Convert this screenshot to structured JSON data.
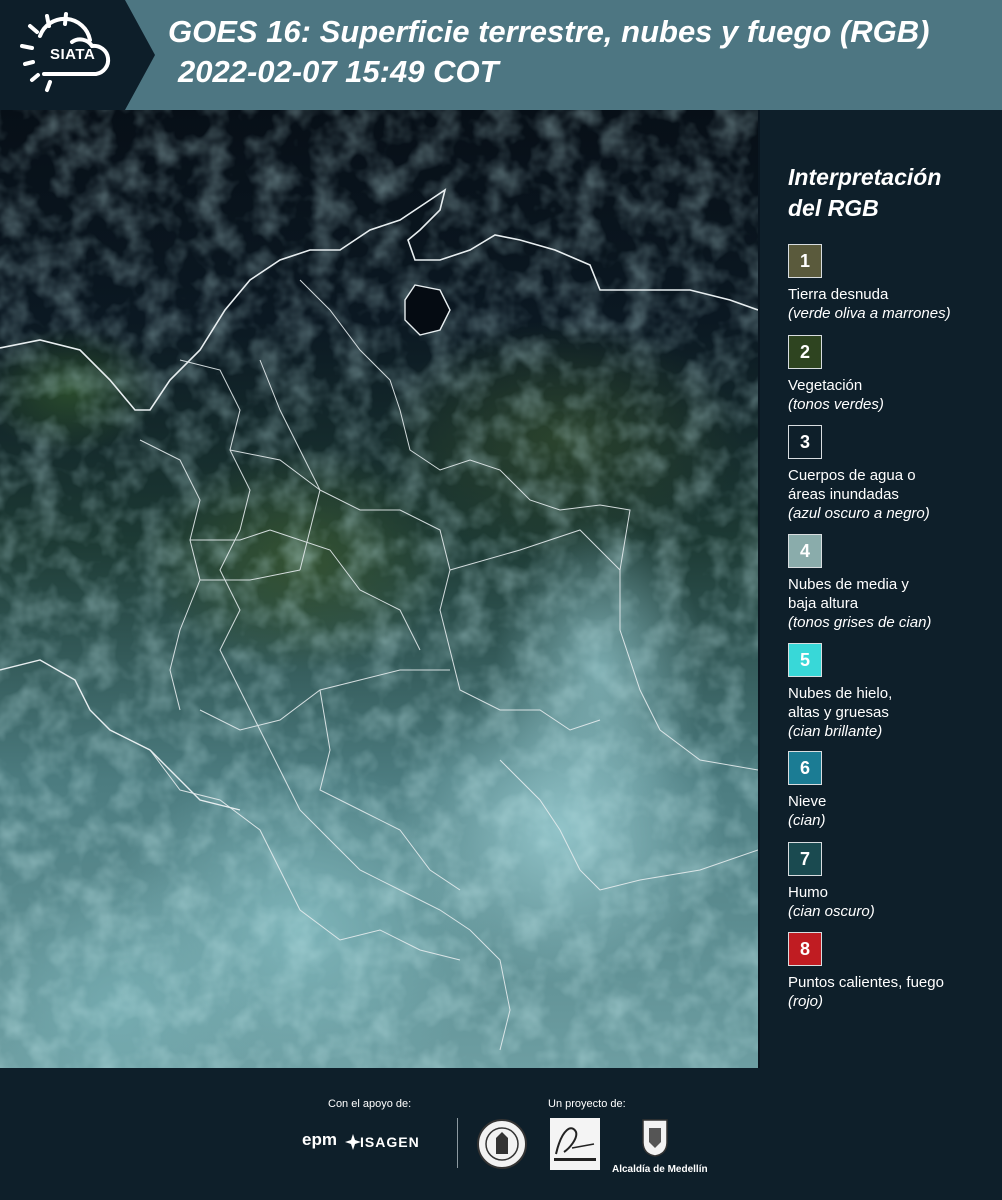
{
  "header": {
    "logo_text": "SIATA",
    "title_line1": "GOES 16: Superficie terrestre, nubes y fuego (RGB)",
    "title_line2": "2022-02-07 15:49 COT"
  },
  "legend": {
    "title_line1": "Interpretación",
    "title_line2": "del RGB",
    "items": [
      {
        "num": "1",
        "color": "#5a5a3c",
        "label": "Tierra desnuda",
        "sub": "(verde oliva a marrones)"
      },
      {
        "num": "2",
        "color": "#2e4420",
        "label": "Vegetación",
        "sub": "(tonos verdes)"
      },
      {
        "num": "3",
        "color": "#0e1f2a",
        "label": "Cuerpos de agua o",
        "label2": "áreas inundadas",
        "sub": "(azul oscuro a negro)"
      },
      {
        "num": "4",
        "color": "#8aacab",
        "label": "Nubes de media y",
        "label2": "baja altura",
        "sub": "(tonos grises de cian)"
      },
      {
        "num": "5",
        "color": "#38d8d8",
        "label": "Nubes de hielo,",
        "label2": "altas y gruesas",
        "sub": "(cian brillante)"
      },
      {
        "num": "6",
        "color": "#1b7c94",
        "label": "Nieve",
        "sub": "(cian)"
      },
      {
        "num": "7",
        "color": "#1a4a50",
        "label": "Humo",
        "sub": "(cian oscuro)"
      },
      {
        "num": "8",
        "color": "#c01c22",
        "label": "Puntos calientes, fuego",
        "sub": "(rojo)"
      }
    ]
  },
  "footer": {
    "support_label": "Con el apoyo de:",
    "project_label": "Un proyecto de:",
    "epm": "epm",
    "isagen": "ISAGEN",
    "alcaldia": "Alcaldía de Medellín"
  }
}
